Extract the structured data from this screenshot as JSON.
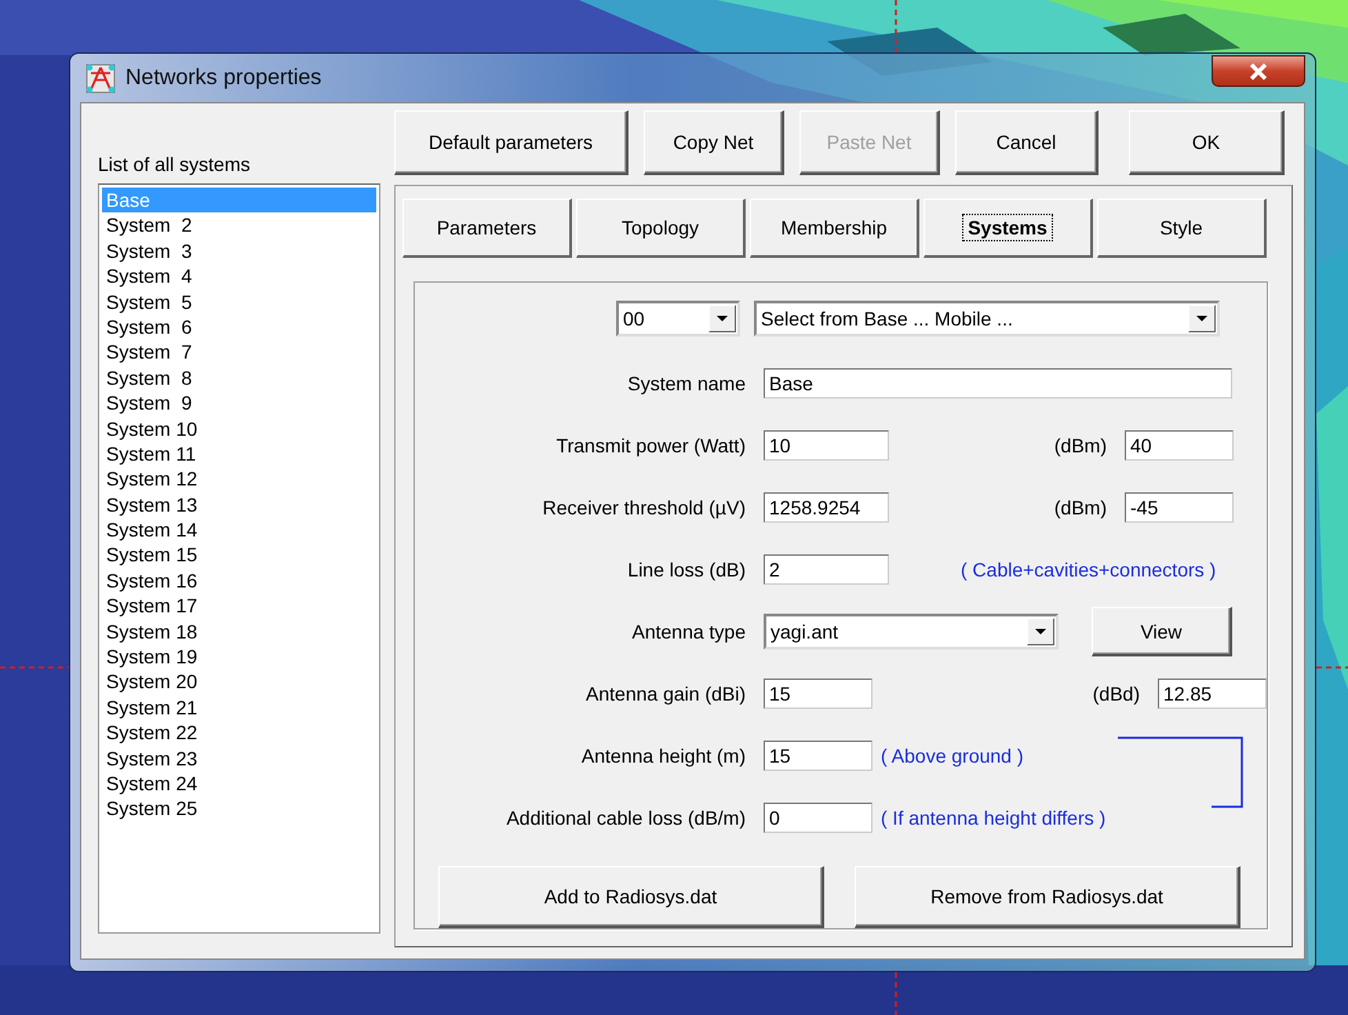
{
  "window": {
    "title": "Networks properties"
  },
  "systems_list": {
    "label": "List of all systems",
    "items": [
      {
        "name": "Base",
        "selected": true
      },
      {
        "name": "System  2",
        "selected": false
      },
      {
        "name": "System  3",
        "selected": false
      },
      {
        "name": "System  4",
        "selected": false
      },
      {
        "name": "System  5",
        "selected": false
      },
      {
        "name": "System  6",
        "selected": false
      },
      {
        "name": "System  7",
        "selected": false
      },
      {
        "name": "System  8",
        "selected": false
      },
      {
        "name": "System  9",
        "selected": false
      },
      {
        "name": "System 10",
        "selected": false
      },
      {
        "name": "System 11",
        "selected": false
      },
      {
        "name": "System 12",
        "selected": false
      },
      {
        "name": "System 13",
        "selected": false
      },
      {
        "name": "System 14",
        "selected": false
      },
      {
        "name": "System 15",
        "selected": false
      },
      {
        "name": "System 16",
        "selected": false
      },
      {
        "name": "System 17",
        "selected": false
      },
      {
        "name": "System 18",
        "selected": false
      },
      {
        "name": "System 19",
        "selected": false
      },
      {
        "name": "System 20",
        "selected": false
      },
      {
        "name": "System 21",
        "selected": false
      },
      {
        "name": "System 22",
        "selected": false
      },
      {
        "name": "System 23",
        "selected": false
      },
      {
        "name": "System 24",
        "selected": false
      },
      {
        "name": "System 25",
        "selected": false
      }
    ]
  },
  "top_buttons": [
    {
      "label": "Default parameters",
      "disabled": false
    },
    {
      "label": "Copy Net",
      "disabled": false
    },
    {
      "label": "Paste Net",
      "disabled": true
    },
    {
      "label": "Cancel",
      "disabled": false
    },
    {
      "label": "OK",
      "disabled": false
    }
  ],
  "tabs": [
    {
      "label": "Parameters",
      "selected": false
    },
    {
      "label": "Topology",
      "selected": false
    },
    {
      "label": "Membership",
      "selected": false
    },
    {
      "label": "Systems",
      "selected": true
    },
    {
      "label": "Style",
      "selected": false
    }
  ],
  "selectors": {
    "code": "00",
    "source": "Select from Base ... Mobile ..."
  },
  "rows": [
    {
      "kind": "wide",
      "label": "System name",
      "value": "Base"
    },
    {
      "kind": "field",
      "label": "Transmit power (Watt)",
      "value": "10",
      "alt_unit": "(dBm)",
      "alt_value": "40"
    },
    {
      "kind": "field",
      "label": "Receiver threshold (µV)",
      "value": "1258.9254",
      "alt_unit": "(dBm)",
      "alt_value": "-45"
    },
    {
      "kind": "field",
      "label": "Line loss (dB)",
      "value": "2",
      "note": "( Cable+cavities+connectors )"
    },
    {
      "kind": "dropdown",
      "label": "Antenna type",
      "value": "yagi.ant",
      "button": "View"
    },
    {
      "kind": "short",
      "label": "Antenna gain (dBi)",
      "value": "15",
      "alt_unit": "(dBd)",
      "alt_value": "12.85"
    },
    {
      "kind": "short",
      "label": "Antenna height (m)",
      "value": "15",
      "note": "( Above ground )"
    },
    {
      "kind": "short",
      "label": "Additional cable loss (dB/m)",
      "value": "0",
      "note": "( If antenna height differs )"
    }
  ],
  "bottom_buttons": [
    "Add to Radiosys.dat",
    "Remove from Radiosys.dat"
  ]
}
